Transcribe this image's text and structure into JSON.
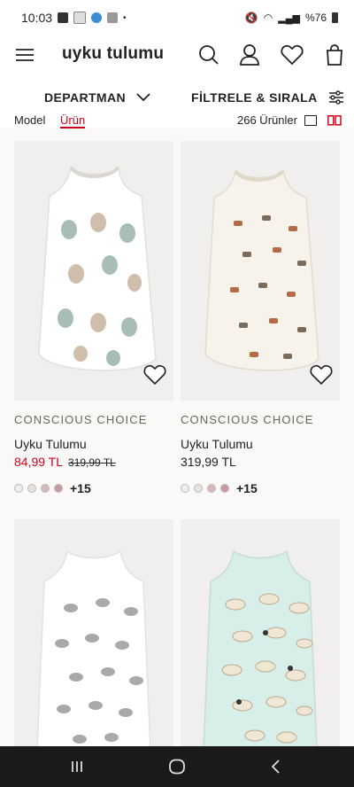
{
  "status": {
    "time": "10:03",
    "battery": "%76",
    "network": "Vo))\nLTE1 ul"
  },
  "header": {
    "logo": "uyku tulumu"
  },
  "filters": {
    "department": "DEPARTMAN",
    "filter_sort": "FİLTRELE & SIRALA"
  },
  "subrow": {
    "model": "Model",
    "product": "Ürün",
    "count": "266 Ürünler"
  },
  "products": [
    {
      "badge": "CONSCIOUS CHOICE",
      "name": "Uyku Tulumu",
      "price": "84,99 TL",
      "old_price": "319,99 TL",
      "more": "+15",
      "pattern": "balloons"
    },
    {
      "badge": "CONSCIOUS CHOICE",
      "name": "Uyku Tulumu",
      "price": "319,99 TL",
      "old_price": "",
      "more": "+15",
      "pattern": "animals"
    },
    {
      "pattern": "elephants"
    },
    {
      "pattern": "clouds"
    }
  ],
  "colors": {
    "sale": "#d0021b",
    "conscious": "#5b6e5b",
    "swatches": [
      "#f0eeea",
      "#e7e2de",
      "#d9b8bd",
      "#c89aa3"
    ]
  }
}
